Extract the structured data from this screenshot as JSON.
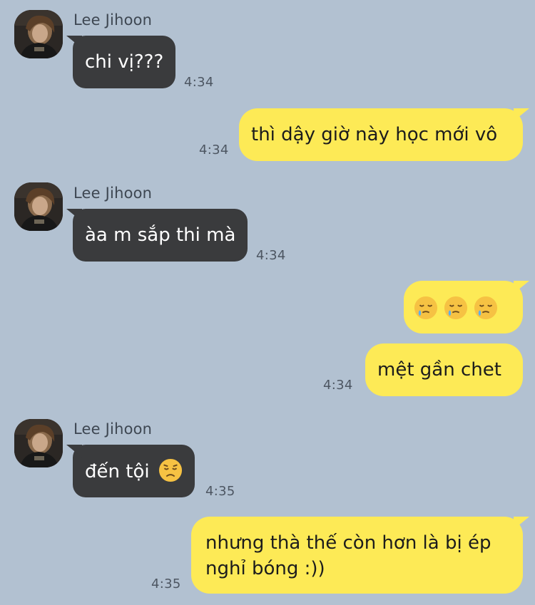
{
  "conversation": {
    "contact_name": "Lee Jihoon",
    "messages": [
      {
        "from": "contact",
        "text": "chi vị???",
        "time": "4:34"
      },
      {
        "from": "me",
        "text": "thì dậy giờ này học mới vô",
        "time": "4:34"
      },
      {
        "from": "contact",
        "text": "àa m sắp thi mà",
        "time": "4:34"
      },
      {
        "from": "me",
        "emoji": [
          "sleepy-face",
          "sleepy-face",
          "sleepy-face"
        ]
      },
      {
        "from": "me",
        "text": "mệt gần chet",
        "time": "4:34"
      },
      {
        "from": "contact",
        "text": "đến tội",
        "emoji": "disappointed-face",
        "time": "4:35"
      },
      {
        "from": "me",
        "text": "nhưng thà thế còn hơn là bị ép nghỉ bóng :))",
        "time": "4:35"
      }
    ]
  },
  "colors": {
    "background": "#b2c1d1",
    "received_bubble": "#3a3b3d",
    "sent_bubble": "#fdea56",
    "timestamp": "#4d5662"
  }
}
